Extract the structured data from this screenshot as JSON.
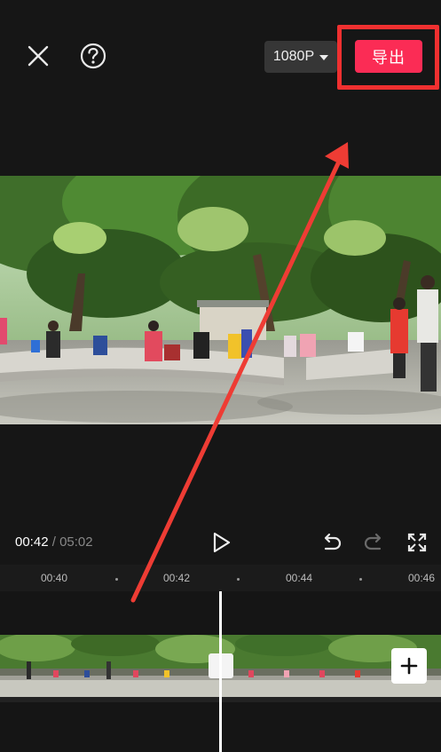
{
  "header": {
    "close_icon": "close-icon",
    "help_icon": "help-icon",
    "resolution_label": "1080P",
    "export_label": "导出"
  },
  "player": {
    "current_time": "00:42",
    "separator": "/",
    "total_time": "05:02",
    "play_icon": "play-icon",
    "undo_icon": "undo-icon",
    "redo_icon": "redo-icon",
    "fullscreen_icon": "fullscreen-icon"
  },
  "timeline": {
    "ticks": [
      "00:40",
      "00:42",
      "00:44",
      "00:46"
    ],
    "add_icon": "plus-icon"
  },
  "annotation": {
    "highlight_color": "#f03030",
    "accent_color": "#fb2c55"
  }
}
